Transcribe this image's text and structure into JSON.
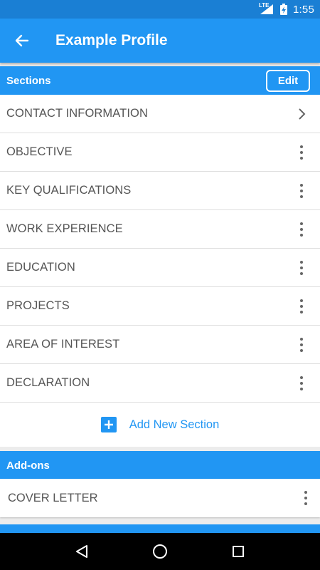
{
  "status_bar": {
    "network": "LTE",
    "time": "1:55"
  },
  "app_bar": {
    "title": "Example Profile",
    "back_icon": "arrow-back-icon"
  },
  "sections": {
    "header": "Sections",
    "edit_label": "Edit",
    "items": [
      {
        "label": "CONTACT INFORMATION",
        "trailing": "chevron-right-icon"
      },
      {
        "label": "OBJECTIVE",
        "trailing": "more-vert-icon"
      },
      {
        "label": "KEY QUALIFICATIONS",
        "trailing": "more-vert-icon"
      },
      {
        "label": "WORK EXPERIENCE",
        "trailing": "more-vert-icon"
      },
      {
        "label": "EDUCATION",
        "trailing": "more-vert-icon"
      },
      {
        "label": "PROJECTS",
        "trailing": "more-vert-icon"
      },
      {
        "label": "AREA OF INTEREST",
        "trailing": "more-vert-icon"
      },
      {
        "label": "DECLARATION",
        "trailing": "more-vert-icon"
      }
    ],
    "add_label": "Add New Section"
  },
  "addons": {
    "header": "Add-ons",
    "items": [
      {
        "label": "COVER LETTER",
        "trailing": "more-vert-icon"
      }
    ]
  },
  "colors": {
    "primary": "#2196f3",
    "status_bar": "#1a7fd4",
    "text": "#555555",
    "background": "#ececec"
  }
}
